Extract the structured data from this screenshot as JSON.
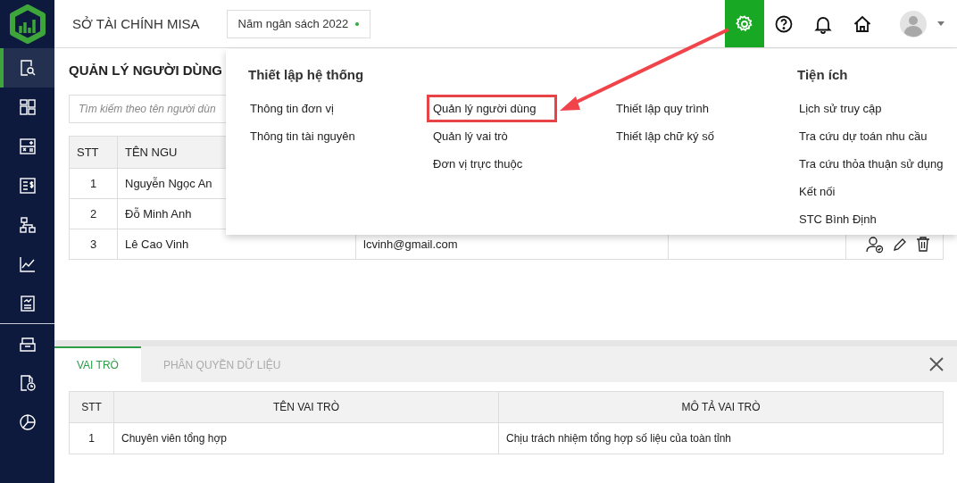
{
  "app": {
    "org_name": "SỞ TÀI CHÍNH MISA",
    "budget_year": {
      "label": "Năm ngân sách 2022",
      "online": true
    }
  },
  "sidebar": {
    "items": [
      {
        "kind": "search-doc",
        "selected": true
      },
      {
        "kind": "dashboard",
        "selected": false
      },
      {
        "kind": "calculator",
        "selected": false
      },
      {
        "kind": "ledger",
        "selected": false
      },
      {
        "kind": "hierarchy",
        "selected": false
      },
      {
        "kind": "chart",
        "selected": false
      },
      {
        "kind": "report",
        "selected": false
      },
      {
        "kind": "inbox",
        "selected": false
      },
      {
        "kind": "history",
        "selected": false
      },
      {
        "kind": "pie",
        "selected": false
      }
    ]
  },
  "toolbar": [
    {
      "kind": "settings",
      "selected": true
    },
    {
      "kind": "help",
      "selected": false
    },
    {
      "kind": "bell",
      "selected": false
    },
    {
      "kind": "home",
      "selected": false
    }
  ],
  "page": {
    "title": "QUẢN LÝ NGƯỜI DÙNG",
    "search": {
      "placeholder": "Tìm kiếm theo tên người dùn"
    },
    "table": {
      "columns": [
        "STT",
        "TÊN NGU"
      ],
      "rows": [
        {
          "stt": "1",
          "name": "Nguyễn Ngọc An"
        },
        {
          "stt": "2",
          "name": "Đỗ Minh Anh"
        },
        {
          "stt": "3",
          "name": "Lê Cao Vinh",
          "email": "lcvinh@gmail.com",
          "actions": true
        }
      ]
    }
  },
  "settings_menu": {
    "sections": [
      {
        "title": "Thiết lập hệ thống",
        "columns": [
          [
            {
              "label": "Thông tin đơn vị",
              "highlighted": false
            },
            {
              "label": "Thông tin tài nguyên",
              "highlighted": false
            }
          ],
          [
            {
              "label": "Quản lý người dùng",
              "highlighted": true
            },
            {
              "label": "Quản lý vai trò",
              "highlighted": false
            },
            {
              "label": "Đơn vị trực thuộc",
              "highlighted": false
            }
          ],
          [
            {
              "label": "Thiết lập quy trình",
              "highlighted": false
            },
            {
              "label": "Thiết lập chữ ký số",
              "highlighted": false
            }
          ]
        ]
      },
      {
        "title": "Tiện ích",
        "columns": [
          [
            {
              "label": "Lịch sử truy cập",
              "highlighted": false
            },
            {
              "label": "Tra cứu dự toán nhu cầu",
              "highlighted": false
            },
            {
              "label": "Tra cứu thỏa thuận sử dụng",
              "highlighted": false
            },
            {
              "label": "Kết nối",
              "highlighted": false
            },
            {
              "label": "STC Bình Định",
              "highlighted": false
            }
          ]
        ]
      }
    ]
  },
  "detail_panel": {
    "tabs": [
      {
        "label": "VAI TRÒ",
        "selected": true
      },
      {
        "label": "PHÂN QUYỀN DỮ LIỆU",
        "selected": false
      }
    ],
    "table": {
      "columns": [
        "STT",
        "TÊN VAI TRÒ",
        "MÔ TẢ VAI TRÒ"
      ],
      "rows": [
        [
          "1",
          "Chuyên viên tổng hợp",
          "Chịu trách nhiệm tổng hợp số liệu của toàn tỉnh"
        ]
      ]
    }
  }
}
